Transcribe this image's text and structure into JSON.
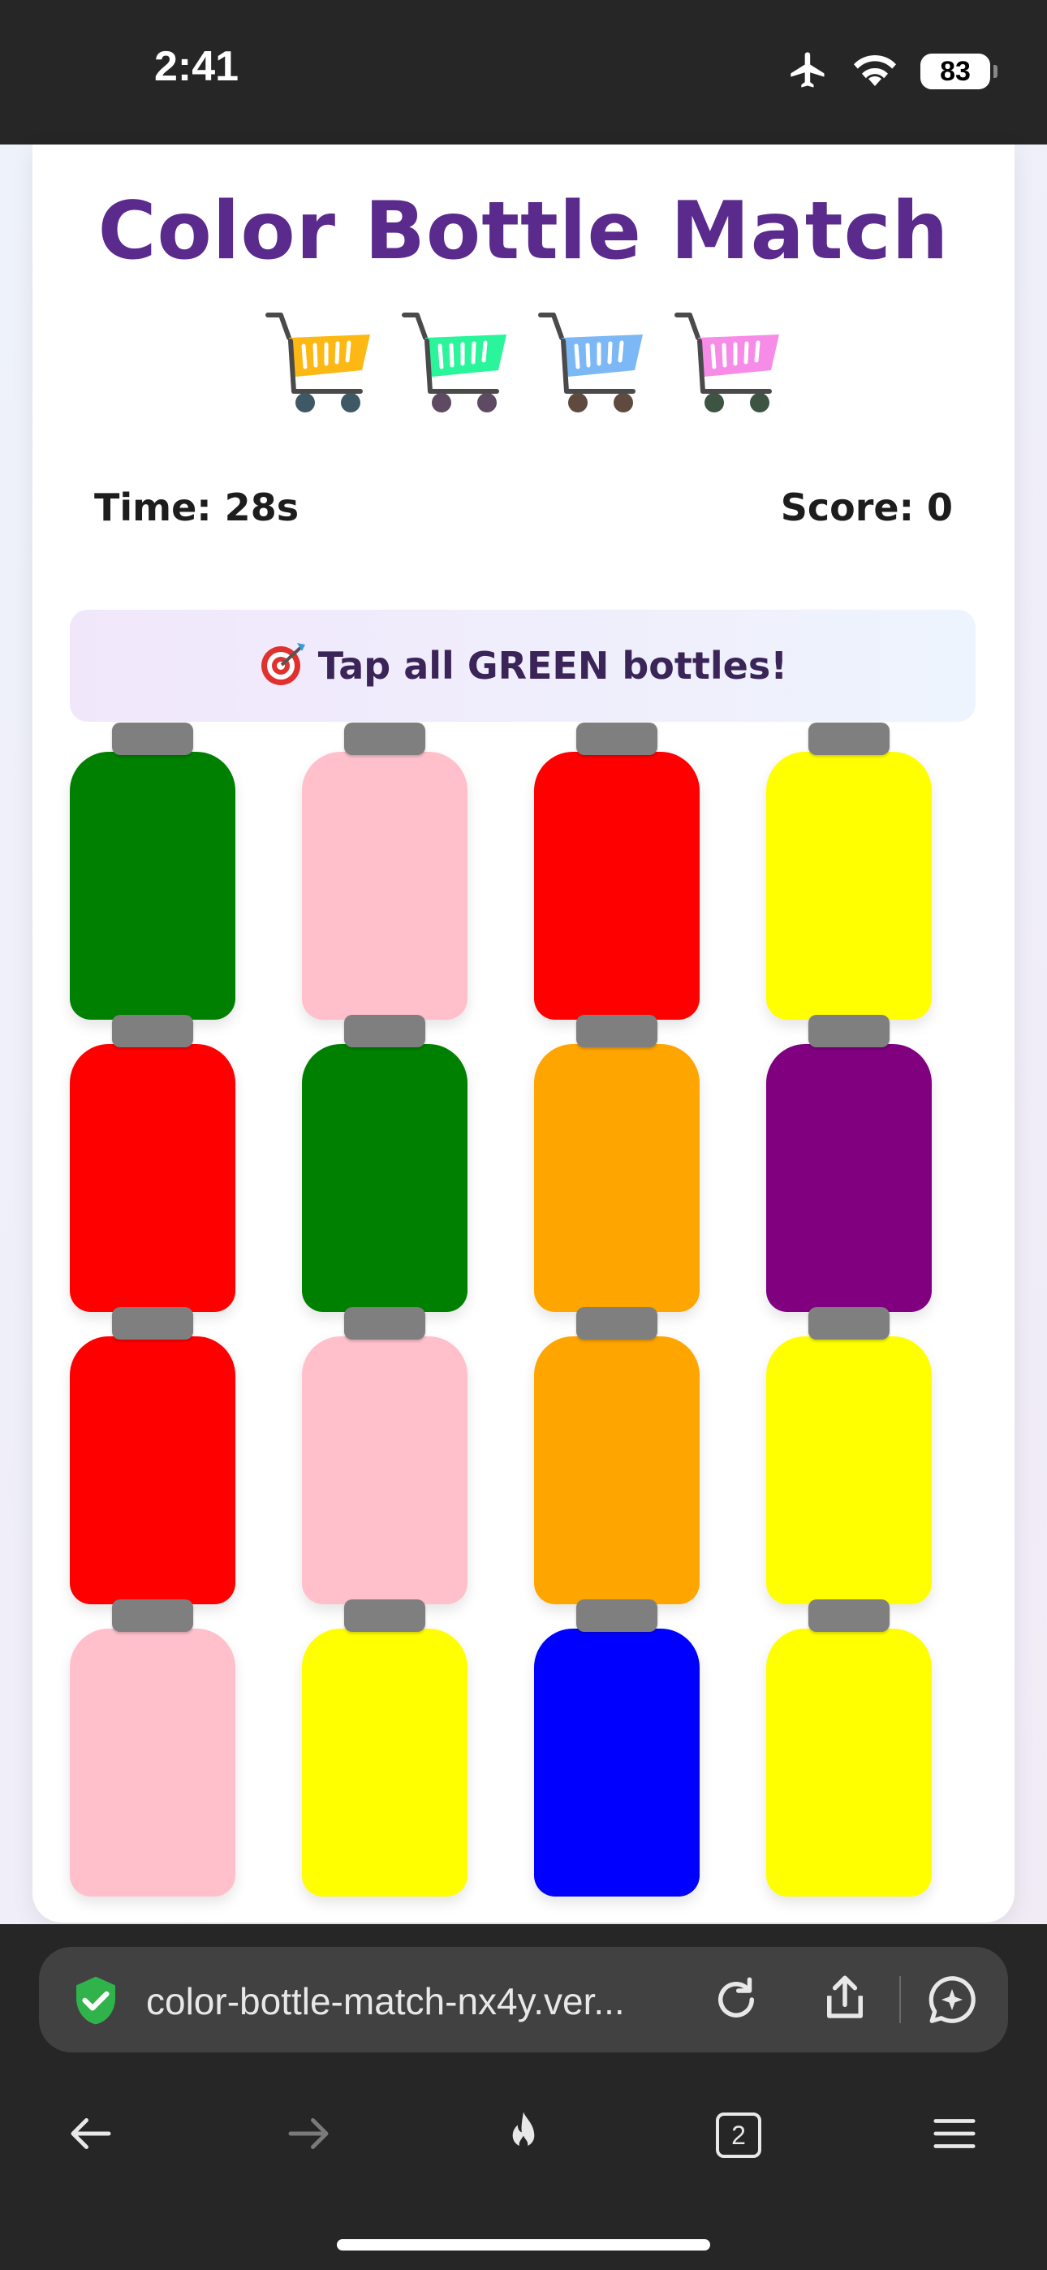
{
  "status_bar": {
    "time": "2:41",
    "battery": "83"
  },
  "game": {
    "title": "Color Bottle Match",
    "cart_colors": [
      "#FDB813",
      "#2BF59A",
      "#7CB8F5",
      "#F78CE8"
    ],
    "time_label": "Time: 28s",
    "score_label": "Score: 0",
    "instruction_icon": "target-icon",
    "instruction": "Tap all GREEN bottles!",
    "bottles": [
      [
        "#008000",
        "#FFC0CB",
        "#FF0000",
        "#FFFF00"
      ],
      [
        "#FF0000",
        "#008000",
        "#FFA500",
        "#800080"
      ],
      [
        "#FF0000",
        "#FFC0CB",
        "#FFA500",
        "#FFFF00"
      ],
      [
        "#FFC0CB",
        "#FFFF00",
        "#0000FF",
        "#FFFF00"
      ]
    ]
  },
  "browser": {
    "url": "color-bottle-match-nx4y.ver...",
    "tab_count": "2",
    "icons": [
      "shield-check-icon",
      "reload-icon",
      "share-icon",
      "ai-chat-icon",
      "back-icon",
      "forward-icon",
      "flame-icon",
      "tabs-icon",
      "menu-icon"
    ]
  }
}
